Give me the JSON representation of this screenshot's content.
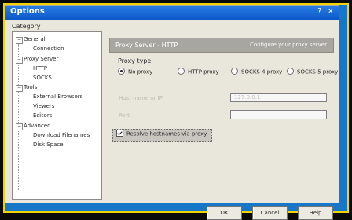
{
  "window": {
    "title": "Options",
    "controls": "? ×",
    "top_label": "Category"
  },
  "tree": {
    "items": [
      {
        "label": "General",
        "expander": "−"
      },
      {
        "label": "Connection"
      },
      {
        "label": "Proxy Server",
        "expander": "−"
      },
      {
        "label": "HTTP"
      },
      {
        "label": "SOCKS"
      },
      {
        "label": "Tools",
        "expander": "−"
      },
      {
        "label": "External Browsers"
      },
      {
        "label": "Viewers"
      },
      {
        "label": "Editors"
      },
      {
        "label": "Advanced",
        "expander": "−"
      },
      {
        "label": "Download Filenames"
      },
      {
        "label": "Disk Space"
      }
    ]
  },
  "header": {
    "left": "Proxy Server - HTTP",
    "right": "Configure your proxy server"
  },
  "proxy": {
    "section_label": "Proxy type",
    "options": [
      {
        "label": "No proxy",
        "selected": true
      },
      {
        "label": "HTTP proxy",
        "selected": false
      },
      {
        "label": "SOCKS 4 proxy",
        "selected": false
      },
      {
        "label": "SOCKS 5 proxy",
        "selected": false
      }
    ]
  },
  "fields": {
    "host_label": "Host name or IP",
    "host_value": "127.0.0.1",
    "port_label": "Port",
    "port_value": ""
  },
  "checkbox": {
    "label": "Resolve hostnames via proxy"
  },
  "buttons": {
    "ok": "OK",
    "cancel": "Cancel",
    "help": "Help"
  }
}
